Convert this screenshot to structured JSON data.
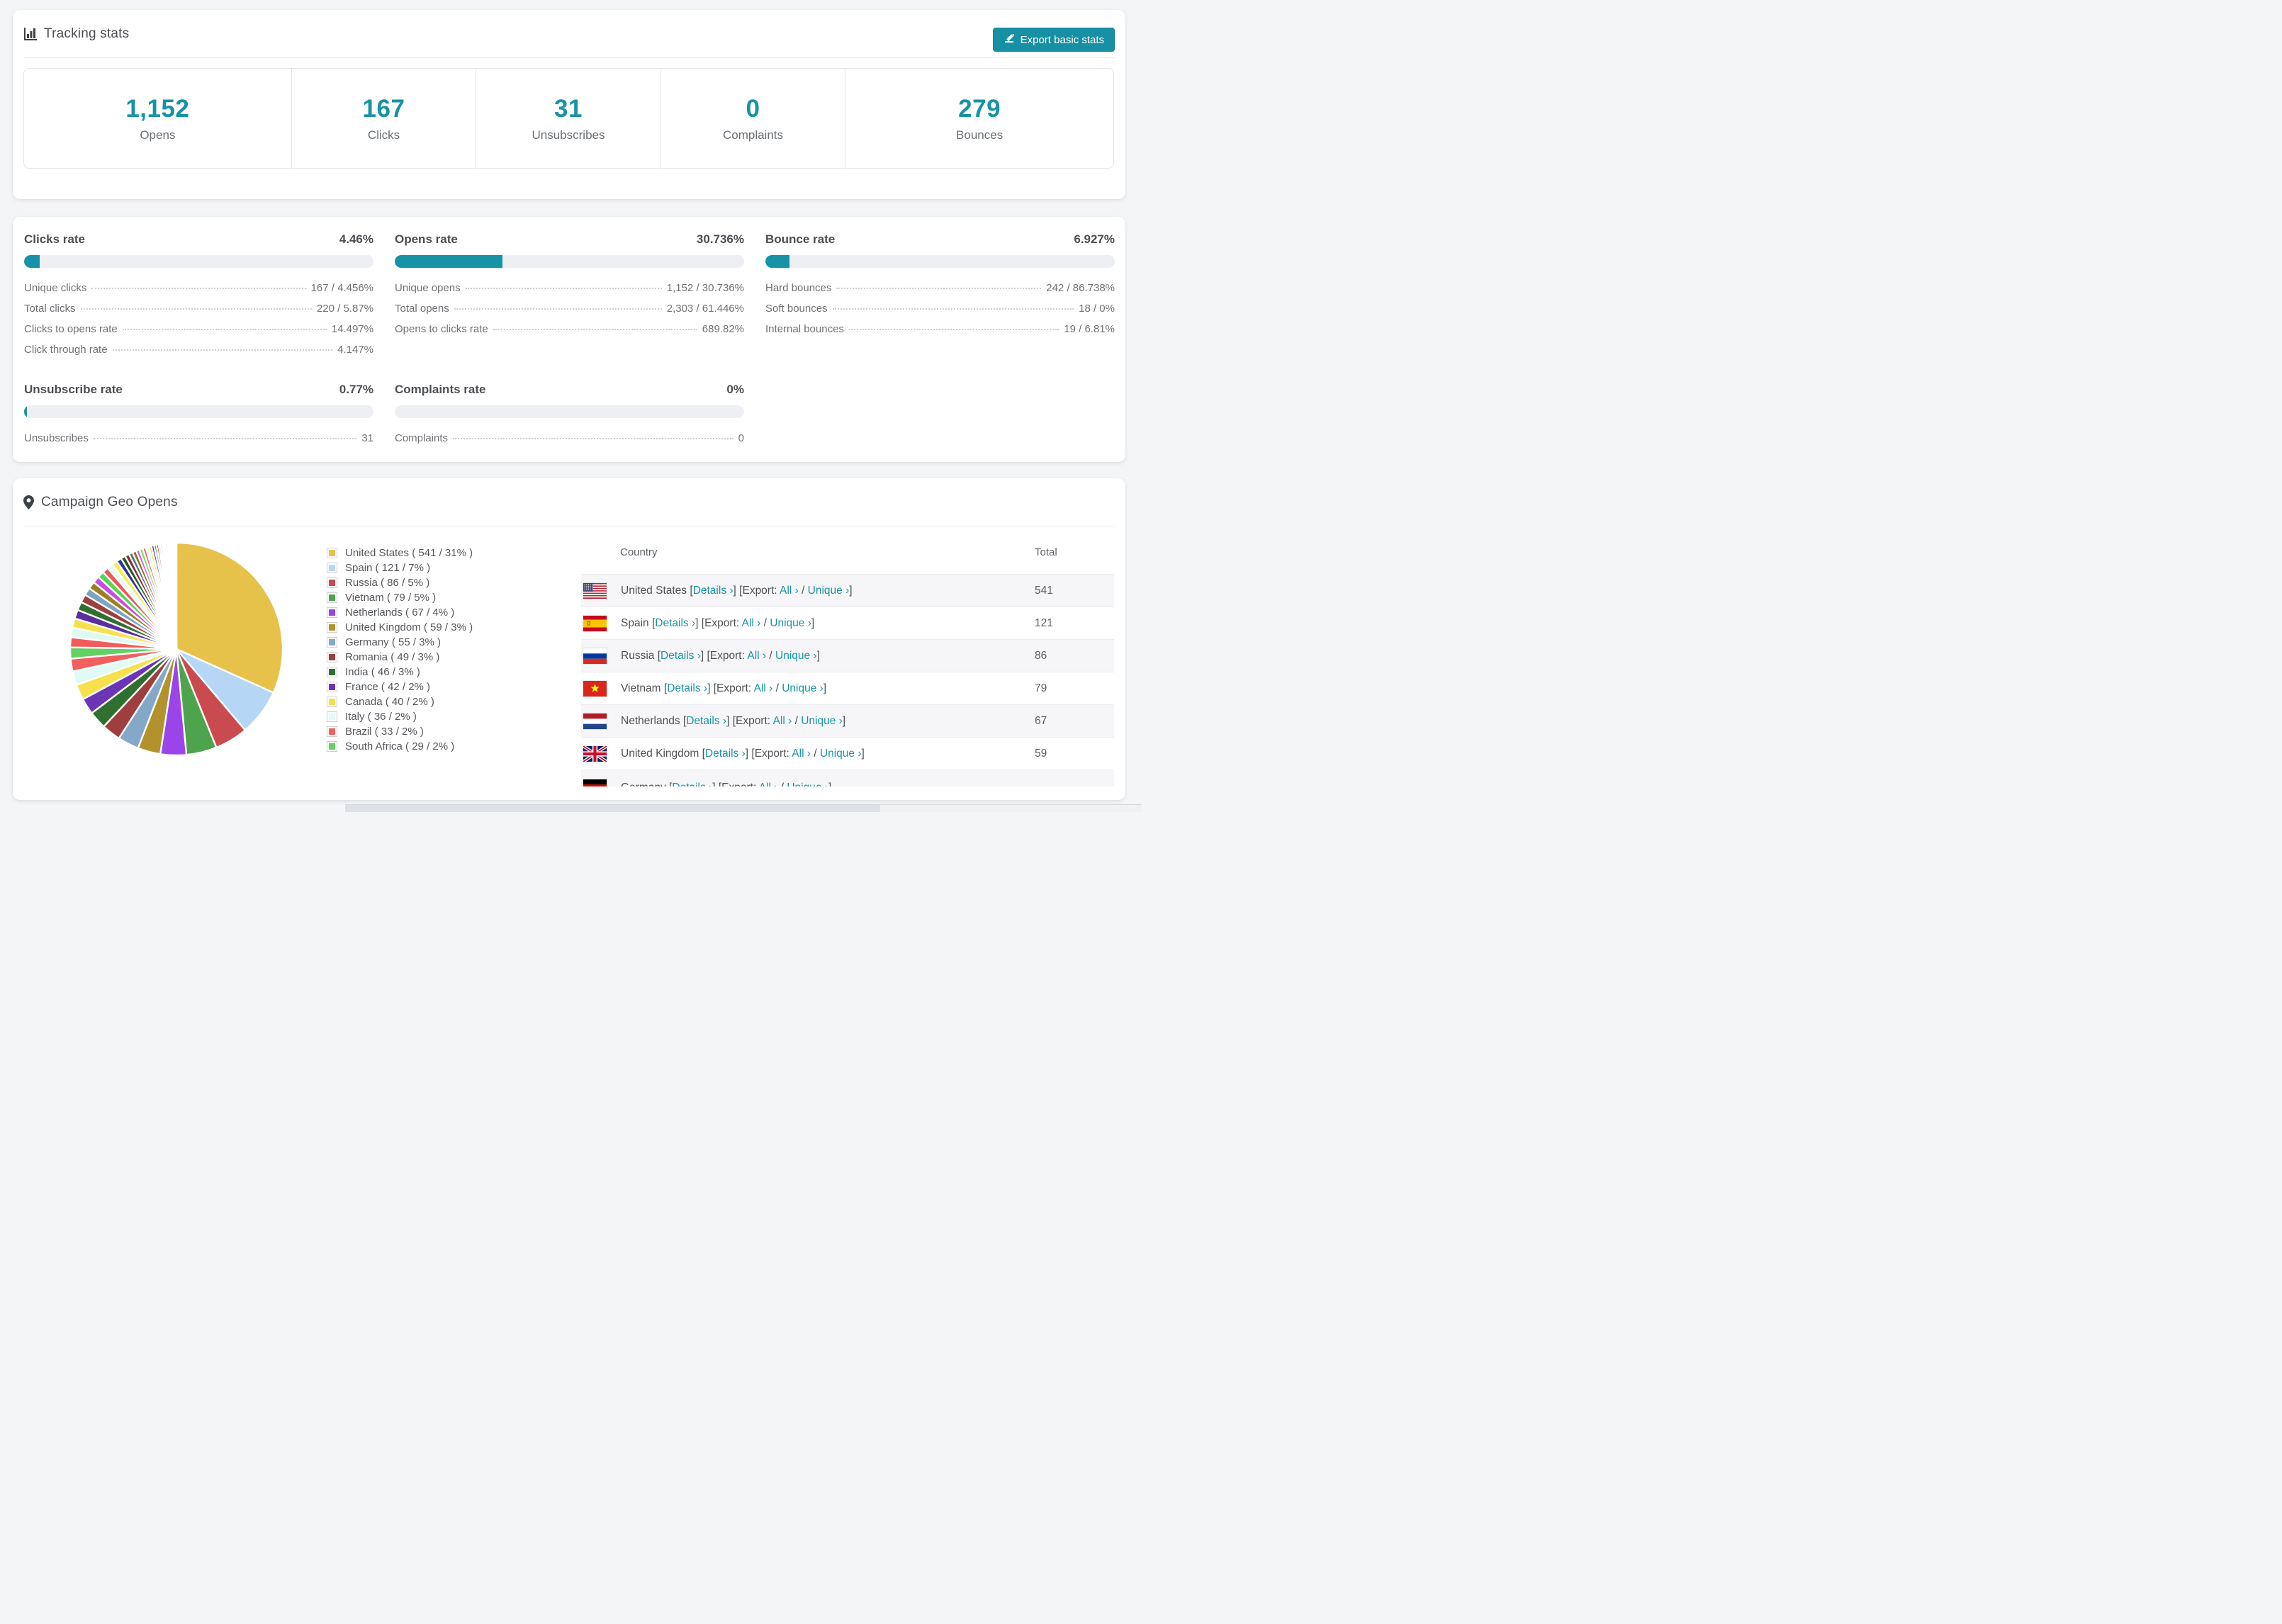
{
  "colors": {
    "accent_teal": "#1792a6",
    "link_teal": "#1a93a7",
    "button_bg": "#1790a4",
    "progress_track": "#edeff2",
    "row_stripe": "#f6f6f8",
    "page_bg": "#f4f5f7"
  },
  "tracking": {
    "title": "Tracking stats",
    "icon": "bar-chart-icon",
    "export_label": "Export basic stats",
    "stats": [
      {
        "value": "1,152",
        "label": "Opens"
      },
      {
        "value": "167",
        "label": "Clicks"
      },
      {
        "value": "31",
        "label": "Unsubscribes"
      },
      {
        "value": "0",
        "label": "Complaints"
      },
      {
        "value": "279",
        "label": "Bounces"
      }
    ]
  },
  "rates": {
    "blocks": [
      {
        "title": "Clicks rate",
        "value": "4.46%",
        "pct": 4.46,
        "rows": [
          {
            "label": "Unique clicks",
            "value": "167 / 4.456%"
          },
          {
            "label": "Total clicks",
            "value": "220 / 5.87%"
          },
          {
            "label": "Clicks to opens rate",
            "value": "14.497%"
          },
          {
            "label": "Click through rate",
            "value": "4.147%"
          }
        ]
      },
      {
        "title": "Opens rate",
        "value": "30.736%",
        "pct": 30.736,
        "rows": [
          {
            "label": "Unique opens",
            "value": "1,152 / 30.736%"
          },
          {
            "label": "Total opens",
            "value": "2,303 / 61.446%"
          },
          {
            "label": "Opens to clicks rate",
            "value": "689.82%"
          }
        ]
      },
      {
        "title": "Bounce rate",
        "value": "6.927%",
        "pct": 6.927,
        "rows": [
          {
            "label": "Hard bounces",
            "value": "242 / 86.738%"
          },
          {
            "label": "Soft bounces",
            "value": "18 / 0%"
          },
          {
            "label": "Internal bounces",
            "value": "19 / 6.81%"
          }
        ]
      },
      {
        "title": "Unsubscribe rate",
        "value": "0.77%",
        "pct": 0.77,
        "rows": [
          {
            "label": "Unsubscribes",
            "value": "31"
          }
        ]
      },
      {
        "title": "Complaints rate",
        "value": "0%",
        "pct": 0,
        "rows": [
          {
            "label": "Complaints",
            "value": "0"
          }
        ]
      }
    ]
  },
  "geo": {
    "title": "Campaign Geo Opens",
    "icon": "map-pin-icon",
    "table": {
      "country_header": "Country",
      "total_header": "Total",
      "links": {
        "details": "Details ›",
        "export": "[Export:",
        "all": "All ›",
        "sep": "/",
        "unique": "Unique ›"
      },
      "rows": [
        {
          "country": "United States",
          "flag": "us",
          "total": "541",
          "clipped": false
        },
        {
          "country": "Spain",
          "flag": "es",
          "total": "121",
          "clipped": false
        },
        {
          "country": "Russia",
          "flag": "ru",
          "total": "86",
          "clipped": false
        },
        {
          "country": "Vietnam",
          "flag": "vn",
          "total": "79",
          "clipped": false
        },
        {
          "country": "Netherlands",
          "flag": "nl",
          "total": "67",
          "clipped": false
        },
        {
          "country": "United Kingdom",
          "flag": "gb",
          "total": "59",
          "clipped": false
        },
        {
          "country": "Germany",
          "flag": "de",
          "total": "",
          "clipped": true
        }
      ]
    },
    "chart_data": {
      "type": "pie",
      "title": "Campaign Geo Opens",
      "unit": "opens",
      "start_angle_deg": -90,
      "direction": "clockwise",
      "legend_position": "right",
      "slices": [
        {
          "label": "United States",
          "value": 541,
          "pct": 31,
          "color": "#e6c24b"
        },
        {
          "label": "Spain",
          "value": 121,
          "pct": 7,
          "color": "#b5d7f5"
        },
        {
          "label": "Russia",
          "value": 86,
          "pct": 5,
          "color": "#c94b4f"
        },
        {
          "label": "Vietnam",
          "value": 79,
          "pct": 5,
          "color": "#4da44d"
        },
        {
          "label": "Netherlands",
          "value": 67,
          "pct": 4,
          "color": "#9b44ea"
        },
        {
          "label": "United Kingdom",
          "value": 59,
          "pct": 3,
          "color": "#b2922c"
        },
        {
          "label": "Germany",
          "value": 55,
          "pct": 3,
          "color": "#84a8c8"
        },
        {
          "label": "Romania",
          "value": 49,
          "pct": 3,
          "color": "#9e3e3e"
        },
        {
          "label": "India",
          "value": 46,
          "pct": 3,
          "color": "#2f7030"
        },
        {
          "label": "France",
          "value": 42,
          "pct": 2,
          "color": "#6c35b5"
        },
        {
          "label": "Canada",
          "value": 40,
          "pct": 2,
          "color": "#f6e14c"
        },
        {
          "label": "Italy",
          "value": 36,
          "pct": 2,
          "color": "#dffbf3"
        },
        {
          "label": "Brazil",
          "value": 33,
          "pct": 2,
          "color": "#f25f5f"
        },
        {
          "label": "South Africa",
          "value": 29,
          "pct": 2,
          "color": "#62d063"
        }
      ],
      "unlabeled_tail_estimated_values": [
        26,
        25,
        24,
        23,
        22,
        21,
        20,
        19,
        18,
        17,
        16,
        15,
        14,
        13,
        12,
        11,
        10,
        10,
        9,
        9,
        8,
        8,
        7,
        7,
        6,
        6,
        5,
        5,
        4,
        4,
        4,
        3,
        3,
        3,
        2,
        2,
        2,
        2,
        1,
        1,
        1,
        1,
        1,
        1,
        1
      ],
      "tail_palette": [
        "#f05c5c",
        "#dff8f0",
        "#f6e14c",
        "#5b2f9b",
        "#2f7030",
        "#9e3e3e",
        "#7fa3c2",
        "#9a8020",
        "#cb4ce0",
        "#5bd35b",
        "#ef5858",
        "#e6fbf9",
        "#f4ee4e",
        "#34309b",
        "#1e5a23",
        "#8b2a2a",
        "#52708a",
        "#857518",
        "#e05ce0",
        "#66e566"
      ]
    }
  }
}
